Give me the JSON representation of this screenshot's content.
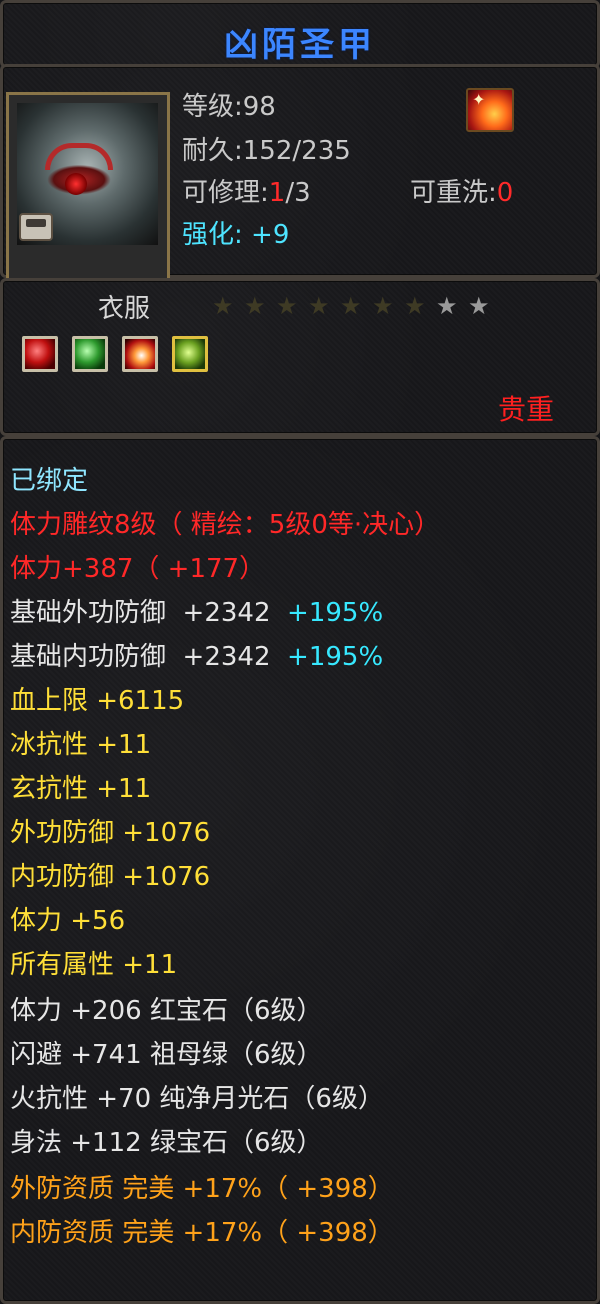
{
  "item_name": "凶陌圣甲",
  "info": {
    "level_label": "等级:",
    "level_value": "98",
    "durability_label": "耐久:",
    "durability_value": "152/235",
    "repair_label": "可修理:",
    "repair_current": "1",
    "repair_max": "/3",
    "rewash_label": "可重洗:",
    "rewash_value": "0",
    "enhance_label": "强化:",
    "enhance_value": "+9"
  },
  "type": {
    "label": "衣服",
    "stars_filled": 7,
    "stars_total": 9,
    "gems": [
      "ruby-gem-icon",
      "emerald-gem-icon",
      "fire-gem-icon",
      "jade-gem-icon"
    ],
    "rarity": "贵重"
  },
  "attributes": {
    "bound": "已绑定",
    "engraving": "体力雕纹8级（ 精绘：5级0等·决心）",
    "engraving_stat": "体力+387（ +177）",
    "base_ext_def_name": "基础外功防御",
    "base_ext_def_value": "+2342",
    "base_ext_def_pct": "+195%",
    "base_int_def_name": "基础内功防御",
    "base_int_def_value": "+2342",
    "base_int_def_pct": "+195%",
    "hp_max": "血上限  +6115",
    "ice_res": "冰抗性  +11",
    "mystic_res": "玄抗性  +11",
    "ext_def": "外功防御  +1076",
    "int_def": "内功防御  +1076",
    "stamina": "体力  +56",
    "all_attr": "所有属性  +11",
    "gem_stamina": "体力  +206  红宝石（6级）",
    "gem_dodge": "闪避  +741  祖母绿（6级）",
    "gem_fire": "火抗性  +70  纯净月光石（6级）",
    "gem_agility": "身法  +112  绿宝石（6级）",
    "ext_quality": "外防资质   完美  +17%（ +398）",
    "int_quality": "内防资质   完美  +17%（ +398）"
  },
  "colors": {
    "title": "#3c86ff",
    "red": "#ff2828",
    "gold": "#ffdf38",
    "orange": "#ffa21a",
    "cyan": "#37e8ff"
  }
}
